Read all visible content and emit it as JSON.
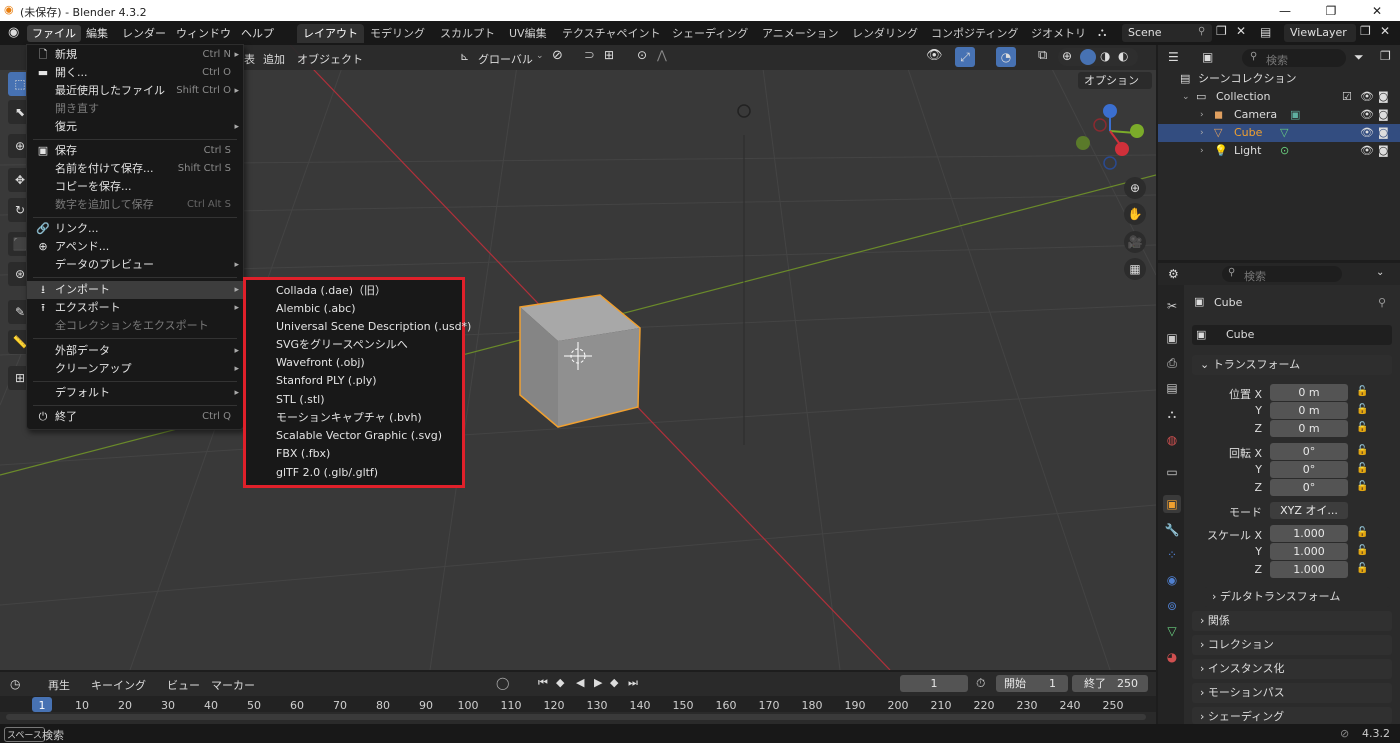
{
  "window": {
    "title": "(未保存) - Blender 4.3.2",
    "controls": [
      "—",
      "❐",
      "✕"
    ]
  },
  "topbar": {
    "menus": [
      "ファイル",
      "編集",
      "レンダー",
      "ウィンドウ",
      "ヘルプ"
    ],
    "workspaces": [
      "レイアウト",
      "モデリング",
      "スカルプト",
      "UV編集",
      "テクスチャペイント",
      "シェーディング",
      "アニメーション",
      "レンダリング",
      "コンポジティング",
      "ジオメトリ"
    ],
    "scene": "Scene",
    "view_layer": "ViewLayer"
  },
  "viewport_header": {
    "menus": [
      "表",
      "追加",
      "オブジェクト"
    ],
    "orientation": "グローバル",
    "options": "オプション"
  },
  "file_menu": {
    "items": [
      {
        "icon": "new-file-icon",
        "glyph": "🗋",
        "label": "新規",
        "shortcut": "Ctrl N",
        "arrow": "▸",
        "disabled": false
      },
      {
        "icon": "folder-icon",
        "glyph": "▬",
        "label": "開く...",
        "shortcut": "Ctrl O",
        "arrow": "",
        "disabled": false
      },
      {
        "icon": "",
        "glyph": "",
        "label": "最近使用したファイル",
        "shortcut": "Shift Ctrl O",
        "arrow": "▸",
        "disabled": false
      },
      {
        "icon": "",
        "glyph": "",
        "label": "開き直す",
        "shortcut": "",
        "arrow": "",
        "disabled": true
      },
      {
        "icon": "",
        "glyph": "",
        "label": "復元",
        "shortcut": "",
        "arrow": "▸",
        "disabled": false
      },
      {
        "icon": "save-icon",
        "glyph": "▣",
        "label": "保存",
        "shortcut": "Ctrl S",
        "arrow": "",
        "disabled": false
      },
      {
        "icon": "",
        "glyph": "",
        "label": "名前を付けて保存...",
        "shortcut": "Shift Ctrl S",
        "arrow": "",
        "disabled": false
      },
      {
        "icon": "",
        "glyph": "",
        "label": "コピーを保存...",
        "shortcut": "",
        "arrow": "",
        "disabled": false
      },
      {
        "icon": "",
        "glyph": "",
        "label": "数字を追加して保存",
        "shortcut": "Ctrl Alt S",
        "arrow": "",
        "disabled": true
      },
      {
        "icon": "link-icon",
        "glyph": "🔗",
        "label": "リンク...",
        "shortcut": "",
        "arrow": "",
        "disabled": false
      },
      {
        "icon": "append-icon",
        "glyph": "⊕",
        "label": "アペンド...",
        "shortcut": "",
        "arrow": "",
        "disabled": false
      },
      {
        "icon": "",
        "glyph": "",
        "label": "データのプレビュー",
        "shortcut": "",
        "arrow": "▸",
        "disabled": false
      },
      {
        "icon": "import-icon",
        "glyph": "⭳",
        "label": "インポート",
        "shortcut": "",
        "arrow": "▸",
        "disabled": false
      },
      {
        "icon": "export-icon",
        "glyph": "⭱",
        "label": "エクスポート",
        "shortcut": "",
        "arrow": "▸",
        "disabled": false
      },
      {
        "icon": "",
        "glyph": "",
        "label": "全コレクションをエクスポート",
        "shortcut": "",
        "arrow": "",
        "disabled": true
      },
      {
        "icon": "",
        "glyph": "",
        "label": "外部データ",
        "shortcut": "",
        "arrow": "▸",
        "disabled": false
      },
      {
        "icon": "",
        "glyph": "",
        "label": "クリーンアップ",
        "shortcut": "",
        "arrow": "▸",
        "disabled": false
      },
      {
        "icon": "",
        "glyph": "",
        "label": "デフォルト",
        "shortcut": "",
        "arrow": "▸",
        "disabled": false
      },
      {
        "icon": "quit-icon",
        "glyph": "⏻",
        "label": "終了",
        "shortcut": "Ctrl Q",
        "arrow": "",
        "disabled": false
      }
    ]
  },
  "import_menu": {
    "items": [
      "Collada (.dae)（旧）",
      "Alembic (.abc)",
      "Universal Scene Description (.usd*)",
      "SVGをグリースペンシルへ",
      "Wavefront (.obj)",
      "Stanford PLY (.ply)",
      "STL (.stl)",
      "モーションキャプチャ (.bvh)",
      "Scalable Vector Graphic (.svg)",
      "FBX (.fbx)",
      "glTF 2.0 (.glb/.gltf)"
    ]
  },
  "outliner": {
    "search_placeholder": "検索",
    "scene_collection": "シーンコレクション",
    "collection": "Collection",
    "objects": [
      {
        "name": "Camera",
        "color": "#dddddd",
        "icon_color": "#e0a060"
      },
      {
        "name": "Cube",
        "color": "#f0a030",
        "icon_color": "#e0a060"
      },
      {
        "name": "Light",
        "color": "#dddddd",
        "icon_color": "#e0a060"
      }
    ]
  },
  "properties": {
    "search_placeholder": "検索",
    "object_name": "Cube",
    "data_name": "Cube",
    "transform_header": "トランスフォーム",
    "location": {
      "label": "位置 X",
      "y": "Y",
      "z": "Z",
      "values": [
        "0 m",
        "0 m",
        "0 m"
      ]
    },
    "rotation": {
      "label": "回転 X",
      "y": "Y",
      "z": "Z",
      "values": [
        "0°",
        "0°",
        "0°"
      ]
    },
    "mode_label": "モード",
    "mode_value": "XYZ オイ...",
    "scale": {
      "label": "スケール X",
      "y": "Y",
      "z": "Z",
      "values": [
        "1.000",
        "1.000",
        "1.000"
      ]
    },
    "delta": "デルタトランスフォーム",
    "panels": [
      "関係",
      "コレクション",
      "インスタンス化",
      "モーションパス",
      "シェーディング"
    ]
  },
  "timeline": {
    "menus": [
      "再生",
      "キーイング",
      "ビュー",
      "マーカー"
    ],
    "current_frame": "1",
    "start_label": "開始",
    "start": "1",
    "end_label": "終了",
    "end": "250",
    "ruler": [
      "1",
      "10",
      "20",
      "30",
      "40",
      "50",
      "60",
      "70",
      "80",
      "90",
      "100",
      "110",
      "120",
      "130",
      "140",
      "150",
      "160",
      "170",
      "180",
      "190",
      "200",
      "210",
      "220",
      "230",
      "240",
      "250"
    ]
  },
  "statusbar": {
    "key": "スペース",
    "hint": "検索",
    "version": "4.3.2"
  },
  "colors": {
    "accent": "#4772b3",
    "highlight_border": "#e0202a",
    "selected_object": "#f0a030"
  }
}
